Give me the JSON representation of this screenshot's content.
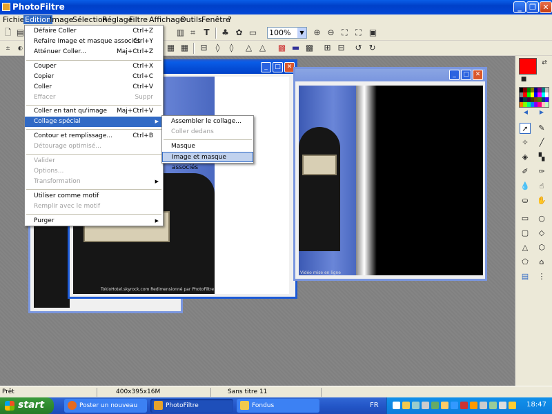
{
  "window": {
    "title": "PhotoFiltre"
  },
  "menubar": [
    "Fichier",
    "Edition",
    "Image",
    "Sélection",
    "Réglage",
    "Filtre",
    "Affichage",
    "Outils",
    "Fenêtre",
    "?"
  ],
  "active_menu": "Edition",
  "toolbar": {
    "zoom_value": "100%"
  },
  "edition_menu": {
    "items": [
      {
        "label": "Défaire Coller",
        "shortcut": "Ctrl+Z"
      },
      {
        "label": "Refaire Image et masque associés",
        "shortcut": "Ctrl+Y"
      },
      {
        "label": "Atténuer Coller...",
        "shortcut": "Maj+Ctrl+Z"
      },
      {
        "label": "Couper",
        "shortcut": "Ctrl+X"
      },
      {
        "label": "Copier",
        "shortcut": "Ctrl+C"
      },
      {
        "label": "Coller",
        "shortcut": "Ctrl+V"
      },
      {
        "label": "Effacer",
        "shortcut": "Suppr"
      },
      {
        "label": "Coller en tant qu'image",
        "shortcut": "Maj+Ctrl+V"
      },
      {
        "label": "Collage spécial",
        "shortcut": ""
      },
      {
        "label": "Contour et remplissage...",
        "shortcut": "Ctrl+B"
      },
      {
        "label": "Détourage optimisé...",
        "shortcut": ""
      },
      {
        "label": "Valider",
        "shortcut": ""
      },
      {
        "label": "Options...",
        "shortcut": ""
      },
      {
        "label": "Transformation",
        "shortcut": ""
      },
      {
        "label": "Utiliser comme motif",
        "shortcut": ""
      },
      {
        "label": "Remplir avec le motif",
        "shortcut": ""
      },
      {
        "label": "Purger",
        "shortcut": ""
      }
    ]
  },
  "collage_submenu": {
    "items": [
      {
        "label": "Assembler le collage..."
      },
      {
        "label": "Coller dedans"
      },
      {
        "label": "Masque"
      },
      {
        "label": "Image et masque associés"
      }
    ]
  },
  "image_watermarks": [
    "TokioHotel.skyrock.com Redimensionné par PhotoFiltre",
    "Vidéo mise en ligne"
  ],
  "statusbar": {
    "state": "Prêt",
    "dimensions": "400x395x16M",
    "doc_name": "Sans titre 11"
  },
  "taskbar": {
    "start": "start",
    "tasks": [
      "Poster un nouveau s...",
      "PhotoFiltre",
      "Fondus"
    ],
    "lang": "FR",
    "clock": "18:47"
  },
  "colors": {
    "foreground": "#ff0000",
    "background": "#ffffff",
    "accent": "#316ac5"
  }
}
